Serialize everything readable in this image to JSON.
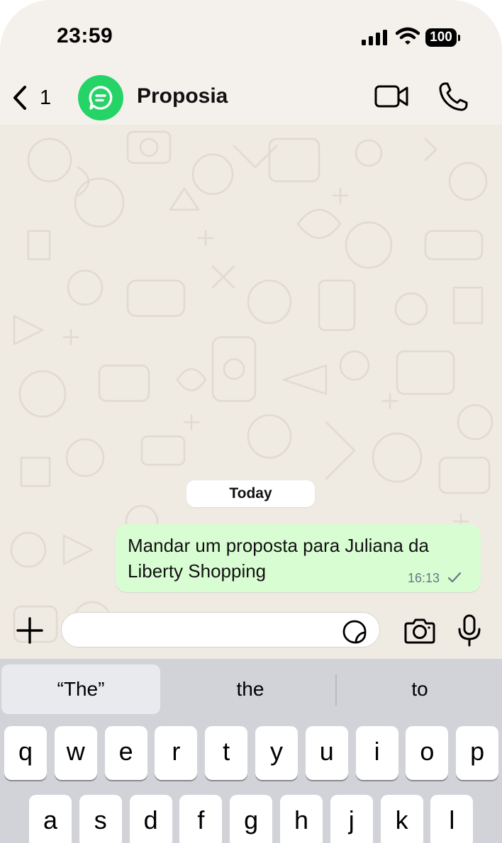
{
  "status_bar": {
    "time": "23:59",
    "battery": "100"
  },
  "header": {
    "back_count": "1",
    "contact_name": "Proposia"
  },
  "chat": {
    "date_label": "Today",
    "messages": [
      {
        "text": "Mandar um proposta para Juliana da Liberty Shopping",
        "time": "16:13",
        "status": "sent-single-check"
      }
    ]
  },
  "input": {
    "value": "",
    "placeholder": ""
  },
  "keyboard": {
    "suggestions": [
      "“The”",
      "the",
      "to"
    ],
    "row1": [
      "q",
      "w",
      "e",
      "r",
      "t",
      "y",
      "u",
      "i",
      "o",
      "p"
    ],
    "row2": [
      "a",
      "s",
      "d",
      "f",
      "g",
      "h",
      "j",
      "k",
      "l"
    ]
  },
  "icons": [
    "signal-icon",
    "wifi-icon",
    "battery-icon",
    "back-chevron-icon",
    "proposia-logo-icon",
    "video-camera-icon",
    "phone-icon",
    "plus-icon",
    "sticker-icon",
    "camera-icon",
    "microphone-icon",
    "checkmark-icon"
  ],
  "colors": {
    "accent_green": "#25d366",
    "bubble_outgoing": "#d9fdd3",
    "chat_background": "#efeae2",
    "header_background": "#f4f1ec",
    "keyboard_background": "#d1d3d9"
  }
}
